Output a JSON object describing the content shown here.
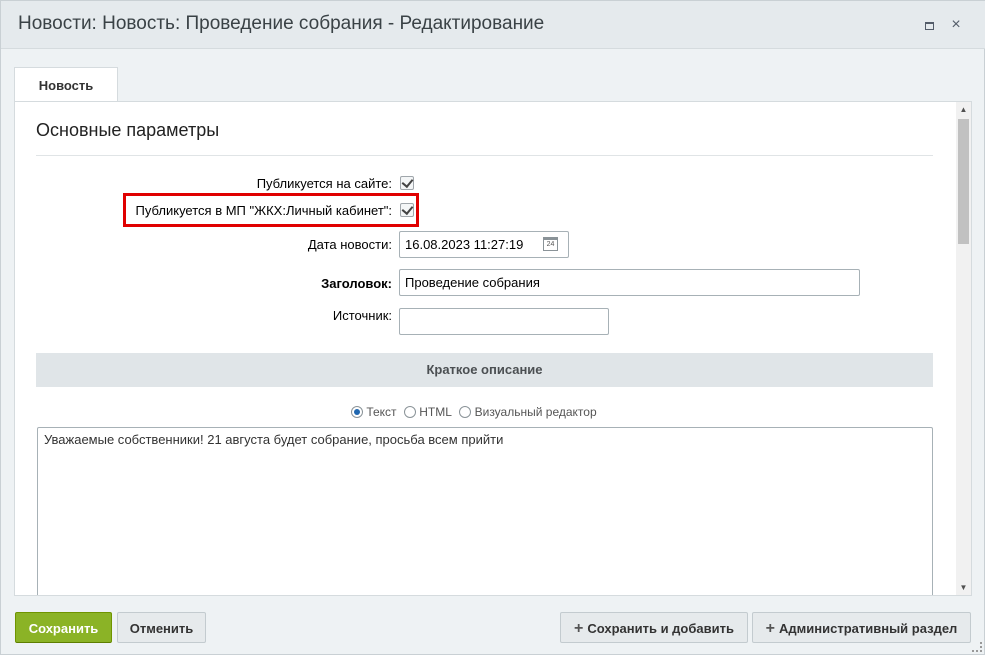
{
  "window": {
    "title": "Новости: Новость: Проведение собрания - Редактирование",
    "maximize_icon": "maximize-icon",
    "close_icon": "close-icon",
    "close_glyph": "×"
  },
  "tabs": [
    {
      "label": "Новость"
    }
  ],
  "form": {
    "section_title": "Основные параметры",
    "published_site_label": "Публикуется на сайте:",
    "published_site_checked": true,
    "published_mp_label": "Публикуется в МП \"ЖКХ:Личный кабинет\":",
    "published_mp_checked": true,
    "date_label": "Дата новости:",
    "date_value": "16.08.2023 11:27:19",
    "calendar_day": "24",
    "title_label": "Заголовок:",
    "title_value": "Проведение собрания",
    "source_label": "Источник:",
    "source_value": ""
  },
  "short_description": {
    "header": "Краткое описание",
    "options": [
      "Текст",
      "HTML",
      "Визуальный редактор"
    ],
    "selected": "Текст",
    "text": "Уважаемые собственники! 21 августа будет собрание, просьба всем прийти"
  },
  "footer": {
    "save_label": "Сохранить",
    "cancel_label": "Отменить",
    "save_add_label": "Сохранить и добавить",
    "admin_label": "Административный раздел",
    "plus_glyph": "+"
  },
  "colors": {
    "save_button": "#8bb326",
    "highlight": "#e00000"
  }
}
